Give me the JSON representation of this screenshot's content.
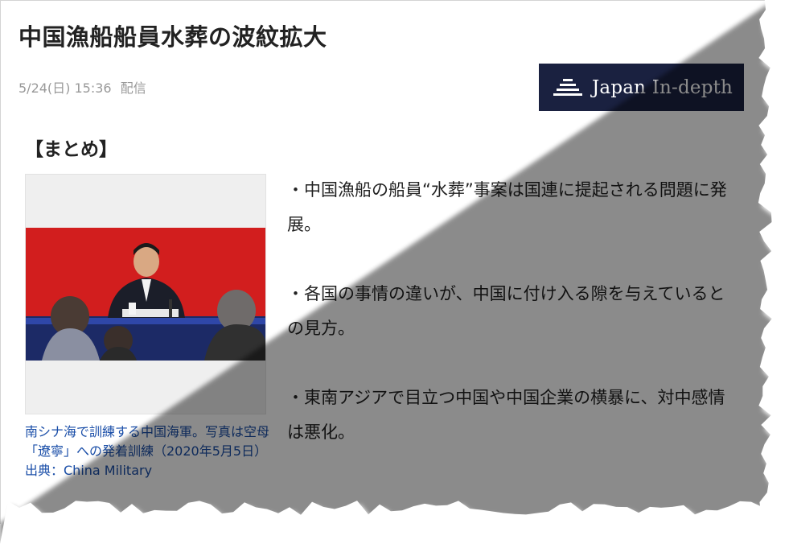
{
  "article": {
    "title": "中国漁船船員水葬の波紋拡大",
    "date": "5/24(日) 15:36",
    "delivery": "配信"
  },
  "logo": {
    "text": "Japan In-depth",
    "background": "#1a2140"
  },
  "summary": {
    "heading": "【まとめ】",
    "points": [
      "・中国漁船の船員“水葬”事案は国連に提起される問題に発展。",
      "・各国の事情の違いが、中国に付け入る隙を与えているとの見方。",
      "・東南アジアで目立つ中国や中国企業の横暴に、対中感情は悪化。"
    ]
  },
  "photo": {
    "caption": "南シナ海で訓練する中国海軍。写真は空母「遼寧」への発着訓練（2020年5月5日）出典：China Military"
  },
  "colors": {
    "title_text": "#222222",
    "date_text": "#999999",
    "caption_link": "#1a4ea8",
    "photo_backdrop": "#d21e1e"
  }
}
